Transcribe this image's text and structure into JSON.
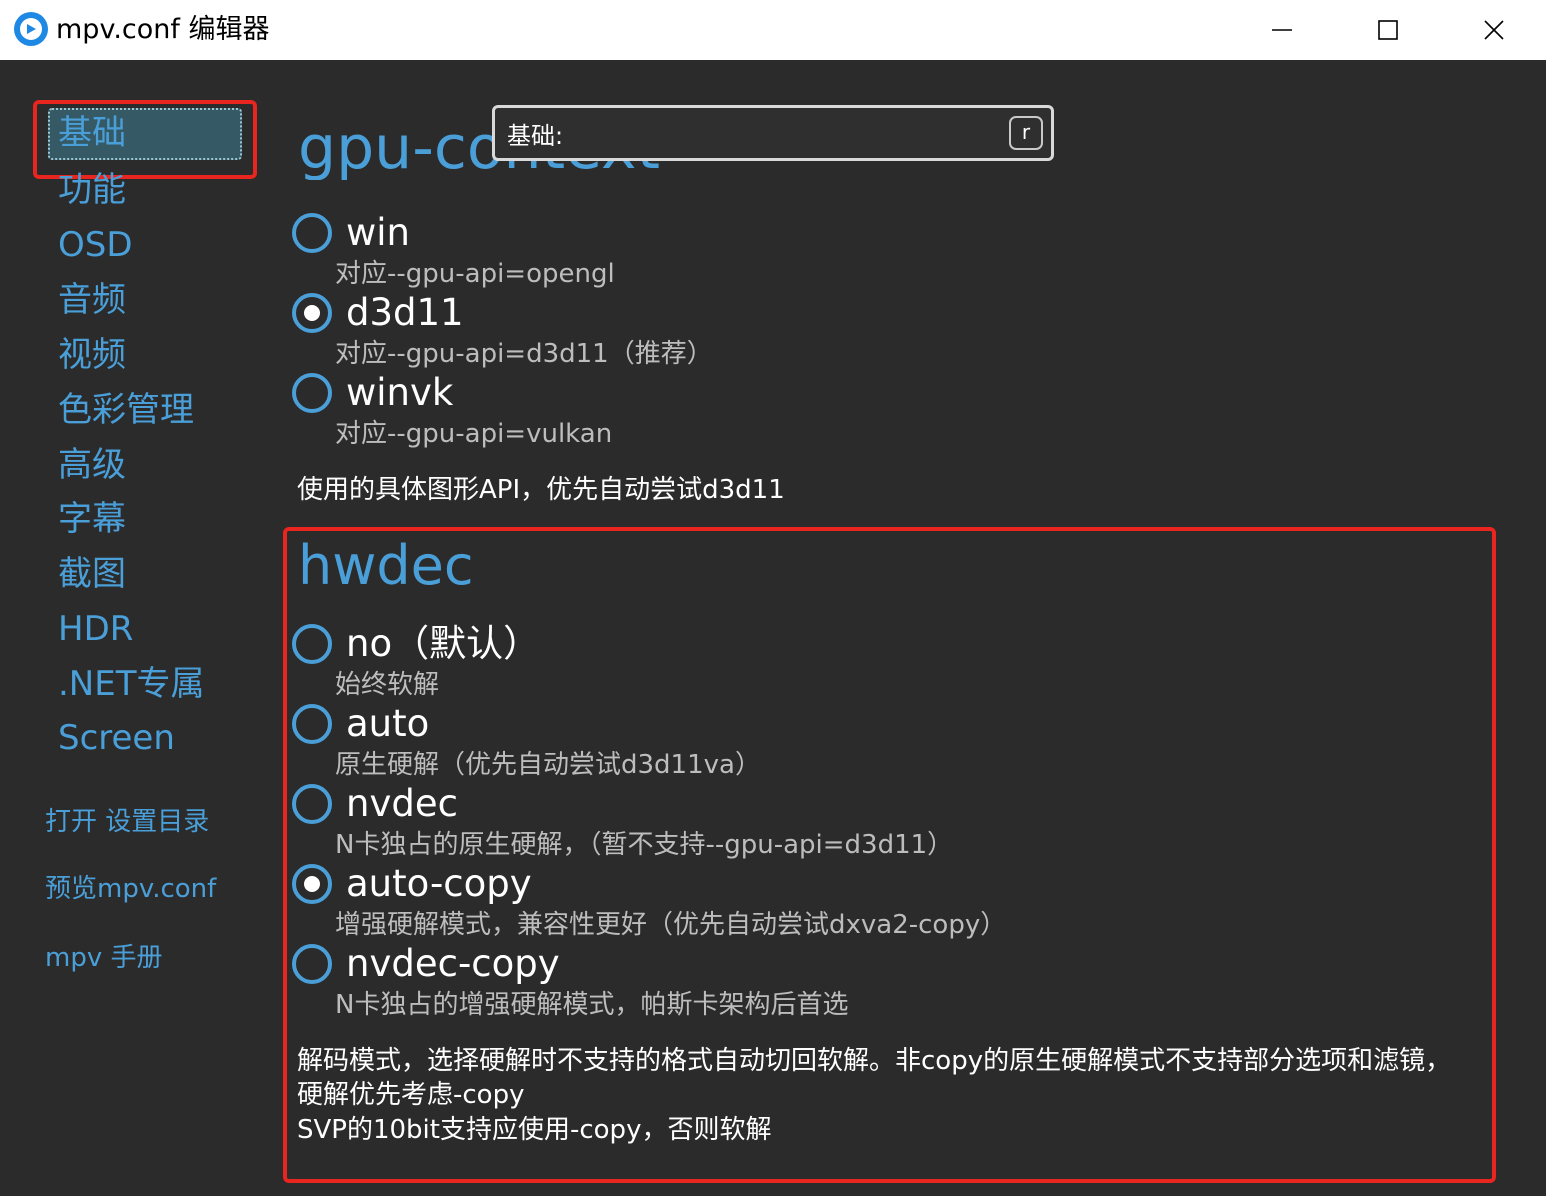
{
  "window": {
    "title": "mpv.conf 编辑器"
  },
  "sidebar": {
    "items": [
      {
        "label": "基础",
        "selected": true
      },
      {
        "label": "功能"
      },
      {
        "label": "OSD"
      },
      {
        "label": "音频"
      },
      {
        "label": "视频"
      },
      {
        "label": "色彩管理"
      },
      {
        "label": "高级"
      },
      {
        "label": "字幕"
      },
      {
        "label": "截图"
      },
      {
        "label": "HDR"
      },
      {
        "label": ".NET专属"
      },
      {
        "label": "Screen"
      }
    ],
    "links": {
      "open_settings": "打开 设置目录",
      "preview": "预览mpv.conf",
      "manual": "mpv 手册"
    }
  },
  "search": {
    "label": "基础:",
    "shortcut": "r"
  },
  "gpu_context": {
    "title": "gpu-context",
    "options": [
      {
        "label": "win",
        "desc": "对应--gpu-api=opengl",
        "checked": false
      },
      {
        "label": "d3d11",
        "desc": "对应--gpu-api=d3d11（推荐）",
        "checked": true
      },
      {
        "label": "winvk",
        "desc": "对应--gpu-api=vulkan",
        "checked": false
      }
    ],
    "description": "使用的具体图形API，优先自动尝试d3d11"
  },
  "hwdec": {
    "title": "hwdec",
    "options": [
      {
        "label": "no（默认）",
        "desc": "始终软解",
        "checked": false
      },
      {
        "label": "auto",
        "desc": "原生硬解（优先自动尝试d3d11va）",
        "checked": false
      },
      {
        "label": "nvdec",
        "desc": "N卡独占的原生硬解，（暂不支持--gpu-api=d3d11）",
        "checked": false
      },
      {
        "label": "auto-copy",
        "desc": "增强硬解模式，兼容性更好（优先自动尝试dxva2-copy）",
        "checked": true
      },
      {
        "label": "nvdec-copy",
        "desc": "N卡独占的增强硬解模式，帕斯卡架构后首选",
        "checked": false
      }
    ],
    "description_lines": [
      "解码模式，选择硬解时不支持的格式自动切回软解。非copy的原生硬解模式不支持部分选项和滤镜，",
      "硬解优先考虑-copy",
      "SVP的10bit支持应使用-copy，否则软解"
    ]
  },
  "colors": {
    "accent": "#4a9fd8",
    "highlight": "#e8251f",
    "background": "#2b2b2b"
  }
}
